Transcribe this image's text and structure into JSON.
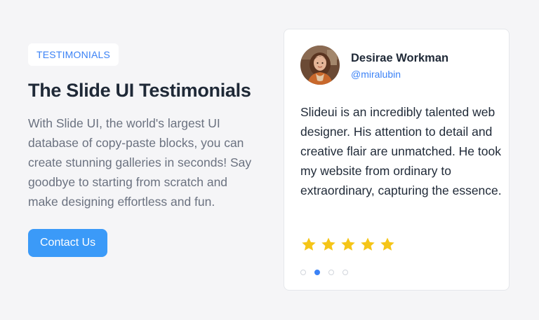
{
  "hero": {
    "tag": "TESTIMONIALS",
    "title": "The Slide UI Testimonials",
    "description": "With Slide UI, the world's largest UI database of copy-paste blocks, you can create stunning galleries in seconds! Say goodbye to starting from scratch and make designing effortless and fun.",
    "cta_label": "Contact Us"
  },
  "testimonial": {
    "name": "Desirae Workman",
    "handle": "@miralubin",
    "quote": "Slideui is an incredibly talented web designer. His attention to detail and creative flair are unmatched. He took my website from ordinary to extraordinary, capturing the essence.",
    "rating": 5,
    "rating_max": 5,
    "avatar_icon": "avatar-photo"
  },
  "carousel": {
    "slide_count": 4,
    "active_index": 1
  },
  "colors": {
    "accent": "#3b82f6",
    "button": "#3b9af8",
    "star": "#f5c518",
    "background": "#f5f5f7"
  }
}
